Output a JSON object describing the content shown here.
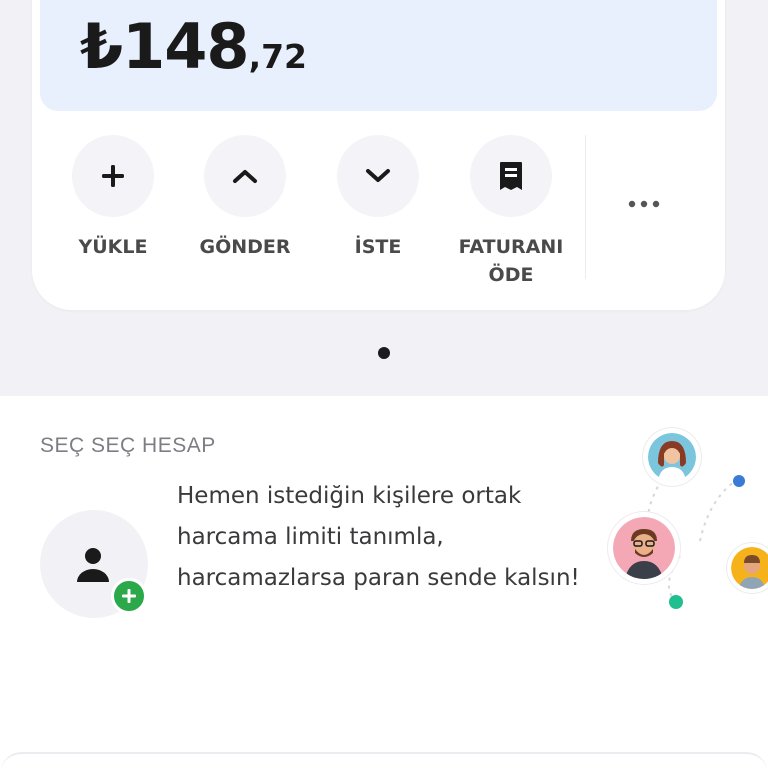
{
  "balance": {
    "currency_symbol": "₺",
    "whole": "148",
    "cents": ",72"
  },
  "actions": [
    {
      "label": "YÜKLE",
      "icon": "plus-icon"
    },
    {
      "label": "GÖNDER",
      "icon": "chevron-up-icon"
    },
    {
      "label": "İSTE",
      "icon": "chevron-down-icon"
    },
    {
      "label": "FATURANI ÖDE",
      "icon": "receipt-icon"
    }
  ],
  "more": {
    "icon": "more-horizontal-icon"
  },
  "promo": {
    "title": "SEÇ SEÇ HESAP",
    "text": "Hemen istediğin kişilere ortak harcama limiti tanımla, harcamazlarsa paran sende kalsın!",
    "icon": "add-person-icon"
  },
  "colors": {
    "balance_background": "#e9f0fd",
    "accent_green": "#2ba84a",
    "accent_blue": "#3a7bd5",
    "accent_teal": "#1fbf8f"
  }
}
